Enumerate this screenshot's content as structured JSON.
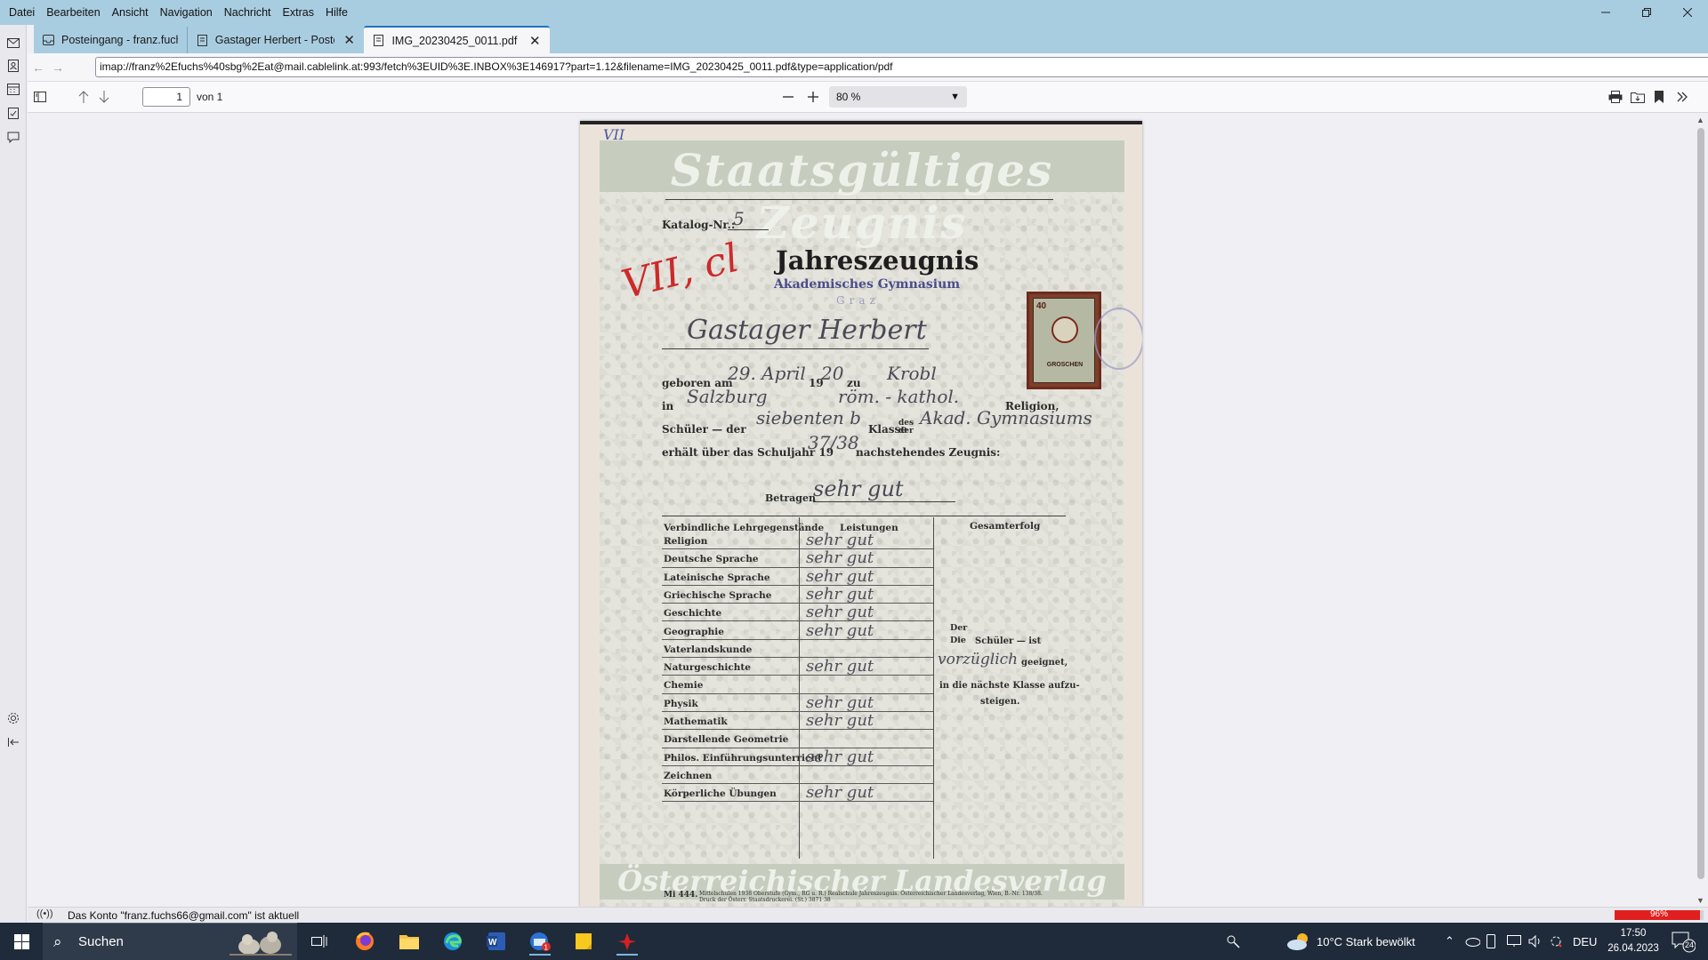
{
  "menu": [
    "Datei",
    "Bearbeiten",
    "Ansicht",
    "Navigation",
    "Nachricht",
    "Extras",
    "Hilfe"
  ],
  "tabs": [
    {
      "label": "Posteingang - franz.fuchs@sbg",
      "icon": "inbox-icon",
      "active": false,
      "closable": false
    },
    {
      "label": "Gastager Herbert - Posteing",
      "icon": "message-icon",
      "active": false,
      "closable": true
    },
    {
      "label": "IMG_20230425_0011.pdf",
      "icon": "pdf-document-icon",
      "active": true,
      "closable": true
    }
  ],
  "url": "imap://franz%2Efuchs%40sbg%2Eat@mail.cablelink.at:993/fetch%3EUID%3E.INBOX%3E146917?part=1.12&filename=IMG_20230425_0011.pdf&type=application/pdf",
  "pdf_toolbar": {
    "page_number": "1",
    "page_count": "von 1",
    "zoom": "80 %"
  },
  "document": {
    "banner_top": "Staatsgültiges Zeugnis",
    "corner_mark": "VII",
    "katalog_label": "Katalog-Nr.:",
    "katalog_value": "5",
    "title": "Jahreszeugnis",
    "school": "Akademisches Gymnasium",
    "city": "Graz",
    "red_mark": "VII, cl",
    "student_name": "Gastager Herbert",
    "born_label": "geboren am",
    "born_day_month": "29. April",
    "born_year_prefix": "19",
    "born_year": "20",
    "born_zu": "zu",
    "born_place": "Krobl",
    "in_label": "in",
    "in_value": "Salzburg",
    "religion_value": "röm. - kathol.",
    "religion_label": "Religion,",
    "schueler_label": "Schüler —  der",
    "klasse_value": "siebenten b",
    "klasse_label": "Klasse",
    "des_der": "des der",
    "school_hand": "Akad. Gymnasiums",
    "schuljahr_label": "erhält über das Schuljahr 19",
    "schuljahr_value": "37/38",
    "schuljahr_suffix": "nachstehendes Zeugnis:",
    "betragen_label": "Betragen",
    "betragen_value": "sehr gut",
    "table_headers": [
      "Verbindliche Lehrgegenstände",
      "Leistungen",
      "Gesamterfolg"
    ],
    "subjects": [
      {
        "name": "Religion",
        "grade": "sehr gut"
      },
      {
        "name": "Deutsche Sprache",
        "grade": "sehr gut"
      },
      {
        "name": "Lateinische Sprache",
        "grade": "sehr gut"
      },
      {
        "name": "Griechische Sprache",
        "grade": "sehr gut"
      },
      {
        "name": "Geschichte",
        "grade": "sehr gut"
      },
      {
        "name": "Geographie",
        "grade": "sehr gut"
      },
      {
        "name": "Vaterlandskunde",
        "grade": ""
      },
      {
        "name": "Naturgeschichte",
        "grade": "sehr gut"
      },
      {
        "name": "Chemie",
        "grade": ""
      },
      {
        "name": "Physik",
        "grade": "sehr gut"
      },
      {
        "name": "Mathematik",
        "grade": "sehr gut"
      },
      {
        "name": "Darstellende Geometrie",
        "grade": ""
      },
      {
        "name": "Philos. Einführungsunterricht",
        "grade": "sehr gut"
      },
      {
        "name": "Zeichnen",
        "grade": ""
      },
      {
        "name": "Körperliche Übungen",
        "grade": "sehr gut"
      }
    ],
    "gesamt_der_die": "Der Die",
    "gesamt_schueler": "Schüler —  ist",
    "gesamt_value": "vorzüglich",
    "gesamt_geeignet": "geeignet,",
    "gesamt_text2": "in die nächste Klasse aufzu-",
    "gesamt_text3": "steigen.",
    "stamp_value": "40",
    "stamp_unit": "GROSCHEN",
    "banner_bottom": "Österreichischer Landesverlag",
    "footer_code": "Mi 444.",
    "footer_text": "Mittelschulen 1938 Oberstufe (Gym., RG u. R.) Realschule Jahreszeugnis. Österreichischer Landesverlag, Wien, B.-Nr. 138/38. Druck der Österr. Staatsdruckerei. (St.) 3871 38"
  },
  "status": {
    "message": "Das Konto \"franz.fuchs66@gmail.com\" ist aktuell",
    "progress_label": "96%",
    "progress": 0.96
  },
  "taskbar": {
    "search_placeholder": "Suchen",
    "weather": "10°C  Stark bewölkt",
    "language": "DEU",
    "time": "17:50",
    "date": "26.04.2023",
    "notifications": "24",
    "mail_badge": "1"
  },
  "colors": {
    "titlebar": "#a9cde0",
    "accent": "#1d74c4",
    "taskbar": "#1f2b3a",
    "progress": "#e02020"
  }
}
